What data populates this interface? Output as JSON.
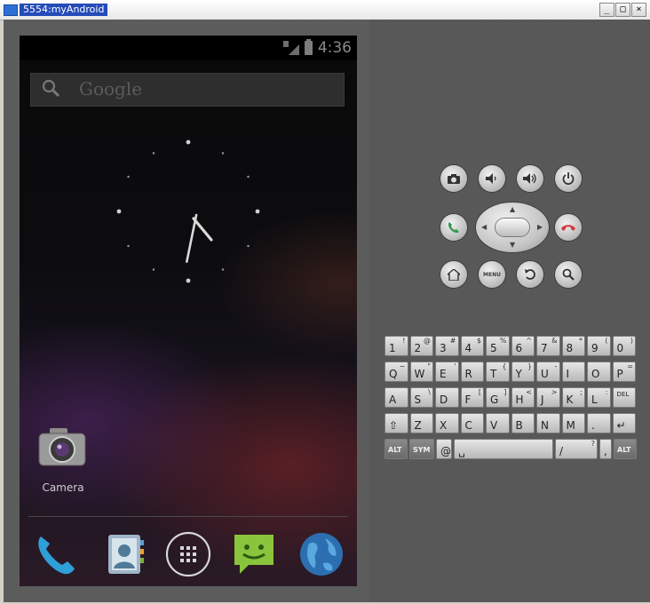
{
  "window": {
    "title": "5554:myAndroid",
    "buttons": [
      "_",
      "□",
      "×"
    ]
  },
  "status_bar": {
    "time": "4:36"
  },
  "search": {
    "placeholder": "Google"
  },
  "home": {
    "apps": [
      {
        "label": "Camera",
        "icon": "camera-icon"
      }
    ]
  },
  "dock": [
    {
      "icon": "phone-icon"
    },
    {
      "icon": "contacts-icon"
    },
    {
      "icon": "all-apps-icon"
    },
    {
      "icon": "messaging-icon"
    },
    {
      "icon": "browser-icon"
    }
  ],
  "controls": {
    "row1": [
      "camera-icon",
      "volume-down-icon",
      "volume-up-icon",
      "power-icon"
    ],
    "row2": [
      "call-icon",
      "dpad",
      "end-call-icon"
    ],
    "row3": [
      "home-icon",
      "menu-button",
      "back-icon",
      "search-icon"
    ],
    "menu_label": "MENU"
  },
  "keyboard": {
    "row1": [
      {
        "k": "1",
        "s": "!"
      },
      {
        "k": "2",
        "s": "@"
      },
      {
        "k": "3",
        "s": "#"
      },
      {
        "k": "4",
        "s": "$"
      },
      {
        "k": "5",
        "s": "%"
      },
      {
        "k": "6",
        "s": "^"
      },
      {
        "k": "7",
        "s": "&"
      },
      {
        "k": "8",
        "s": "*"
      },
      {
        "k": "9",
        "s": "("
      },
      {
        "k": "0",
        "s": ")"
      }
    ],
    "row2": [
      {
        "k": "Q",
        "s": "~"
      },
      {
        "k": "W",
        "s": "\""
      },
      {
        "k": "E",
        "s": "'"
      },
      {
        "k": "R",
        "s": ""
      },
      {
        "k": "T",
        "s": "{"
      },
      {
        "k": "Y",
        "s": "}"
      },
      {
        "k": "U",
        "s": "-"
      },
      {
        "k": "I",
        "s": ""
      },
      {
        "k": "O",
        "s": ""
      },
      {
        "k": "P",
        "s": "="
      }
    ],
    "row3": [
      {
        "k": "A",
        "s": ""
      },
      {
        "k": "S",
        "s": "\\"
      },
      {
        "k": "D",
        "s": ""
      },
      {
        "k": "F",
        "s": "["
      },
      {
        "k": "G",
        "s": "]"
      },
      {
        "k": "H",
        "s": "<"
      },
      {
        "k": "J",
        "s": ">"
      },
      {
        "k": "K",
        "s": ";"
      },
      {
        "k": "L",
        "s": ":"
      },
      {
        "k": "DEL",
        "s": ""
      }
    ],
    "row4": [
      {
        "k": "⇧",
        "s": ""
      },
      {
        "k": "Z",
        "s": ""
      },
      {
        "k": "X",
        "s": ""
      },
      {
        "k": "C",
        "s": ""
      },
      {
        "k": "V",
        "s": ""
      },
      {
        "k": "B",
        "s": ""
      },
      {
        "k": "N",
        "s": ""
      },
      {
        "k": "M",
        "s": ""
      },
      {
        "k": ".",
        "s": ""
      },
      {
        "k": "↵",
        "s": ""
      }
    ],
    "row5": [
      {
        "k": "ALT",
        "s": ""
      },
      {
        "k": "SYM",
        "s": ""
      },
      {
        "k": "@",
        "s": ""
      },
      {
        "k": "␣",
        "s": ""
      },
      {
        "k": "/",
        "s": "?"
      },
      {
        "k": ",",
        "s": ""
      },
      {
        "k": "ALT",
        "s": ""
      }
    ]
  }
}
